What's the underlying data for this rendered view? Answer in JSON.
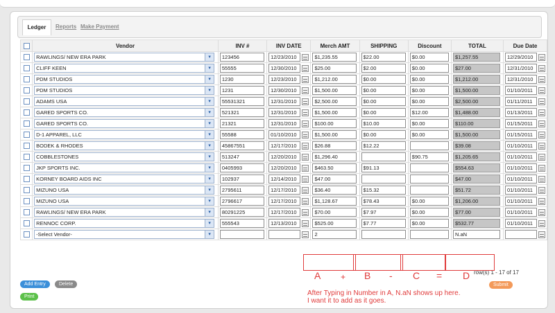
{
  "tabs": [
    {
      "label": "Ledger",
      "active": true
    },
    {
      "label": "Reports"
    },
    {
      "label": "Make Payment"
    }
  ],
  "columns": [
    "Vendor",
    "INV #",
    "INV DATE",
    "Merch AMT",
    "SHIPPING",
    "Discount",
    "TOTAL",
    "Due Date"
  ],
  "rows": [
    {
      "vendor": "RAWLINGS/ NEW ERA PARK",
      "inv": "123456",
      "inv_date": "12/23/2010",
      "merch": "$1,235.55",
      "shipping": "$22.00",
      "discount": "$0.00",
      "total": "$1,257.55",
      "due": "12/29/2010"
    },
    {
      "vendor": "CLIFF KEEN",
      "inv": "55555",
      "inv_date": "12/30/2010",
      "merch": "$25.00",
      "shipping": "$2.00",
      "discount": "$0.00",
      "total": "$27.00",
      "due": "12/31/2010"
    },
    {
      "vendor": "PDM STUDIOS",
      "inv": "1230",
      "inv_date": "12/23/2010",
      "merch": "$1,212.00",
      "shipping": "$0.00",
      "discount": "$0.00",
      "total": "$1,212.00",
      "due": "12/31/2010"
    },
    {
      "vendor": "PDM STUDIOS",
      "inv": "1231",
      "inv_date": "12/30/2010",
      "merch": "$1,500.00",
      "shipping": "$0.00",
      "discount": "$0.00",
      "total": "$1,500.00",
      "due": "01/10/2011"
    },
    {
      "vendor": "ADAMS USA",
      "inv": "55531321",
      "inv_date": "12/31/2010",
      "merch": "$2,500.00",
      "shipping": "$0.00",
      "discount": "$0.00",
      "total": "$2,500.00",
      "due": "01/11/2011"
    },
    {
      "vendor": "GARED SPORTS CO.",
      "inv": "521321",
      "inv_date": "12/31/2010",
      "merch": "$1,500.00",
      "shipping": "$0.00",
      "discount": "$12.00",
      "total": "$1,488.00",
      "due": "01/13/2011"
    },
    {
      "vendor": "GARED SPORTS CO.",
      "inv": "21321",
      "inv_date": "12/31/2010",
      "merch": "$100.00",
      "shipping": "$10.00",
      "discount": "$0.00",
      "total": "$110.00",
      "due": "01/15/2011"
    },
    {
      "vendor": "D-1 APPAREL, LLC",
      "inv": "55588",
      "inv_date": "01/10/2010",
      "merch": "$1,500.00",
      "shipping": "$0.00",
      "discount": "$0.00",
      "total": "$1,500.00",
      "due": "01/15/2011"
    },
    {
      "vendor": "BODEK & RHODES",
      "inv": "45867551",
      "inv_date": "12/17/2010",
      "merch": "$26.88",
      "shipping": "$12.22",
      "discount": "",
      "total": "$39.08",
      "due": "01/10/2011"
    },
    {
      "vendor": "COBBLESTONES",
      "inv": "513247",
      "inv_date": "12/20/2010",
      "merch": "$1,296.40",
      "shipping": "",
      "discount": "$90.75",
      "total": "$1,205.65",
      "due": "01/10/2011"
    },
    {
      "vendor": "JKP SPORTS INC.",
      "inv": "0405993",
      "inv_date": "12/20/2010",
      "merch": "$463.50",
      "shipping": "$91.13",
      "discount": "",
      "total": "$554.63",
      "due": "01/10/2011"
    },
    {
      "vendor": "KORNEY BOARD AIDS INC",
      "inv": "102937",
      "inv_date": "12/14/2010",
      "merch": "$47.00",
      "shipping": "",
      "discount": "",
      "total": "$47.00",
      "due": "01/10/2011"
    },
    {
      "vendor": "MIZUNO USA",
      "inv": "2795611",
      "inv_date": "12/17/2010",
      "merch": "$36.40",
      "shipping": "$15.32",
      "discount": "",
      "total": "$51.72",
      "due": "01/10/2011"
    },
    {
      "vendor": "MIZUNO USA",
      "inv": "2796617",
      "inv_date": "12/17/2010",
      "merch": "$1,128.67",
      "shipping": "$78.43",
      "discount": "$0.00",
      "total": "$1,206.00",
      "due": "01/10/2011"
    },
    {
      "vendor": "RAWLINGS/ NEW ERA PARK",
      "inv": "80291225",
      "inv_date": "12/17/2010",
      "merch": "$70.00",
      "shipping": "$7.97",
      "discount": "$0.00",
      "total": "$77.00",
      "due": "01/10/2011"
    },
    {
      "vendor": "RENNOC CORP.",
      "inv": "555543",
      "inv_date": "12/13/2010",
      "merch": "$525.00",
      "shipping": "$7.77",
      "discount": "$0.00",
      "total": "$532.77",
      "due": "01/10/2011"
    }
  ],
  "new_row": {
    "vendor": "-Select Vendor-",
    "inv": "",
    "inv_date": "",
    "merch": "2",
    "shipping": "",
    "discount": "",
    "total": "N.aN",
    "due": ""
  },
  "row_count": "row(s) 1 - 17 of 17",
  "buttons": {
    "add": "Add Entry",
    "delete": "Delete",
    "print": "Print",
    "submit": "Submit"
  },
  "colors": {
    "blue": "#3b8fd9",
    "gray": "#8a8a8a",
    "green": "#5cc04a",
    "orange": "#f39a5a",
    "annotation": "#e03a3a"
  },
  "annotation": {
    "a": "A",
    "plus": "+",
    "b": "B",
    "minus": "-",
    "c": "C",
    "equals": "=",
    "d": "D",
    "line1": "After Typing in Number in A, N.aN shows up here.",
    "line2": "I want it to add as it goes."
  }
}
